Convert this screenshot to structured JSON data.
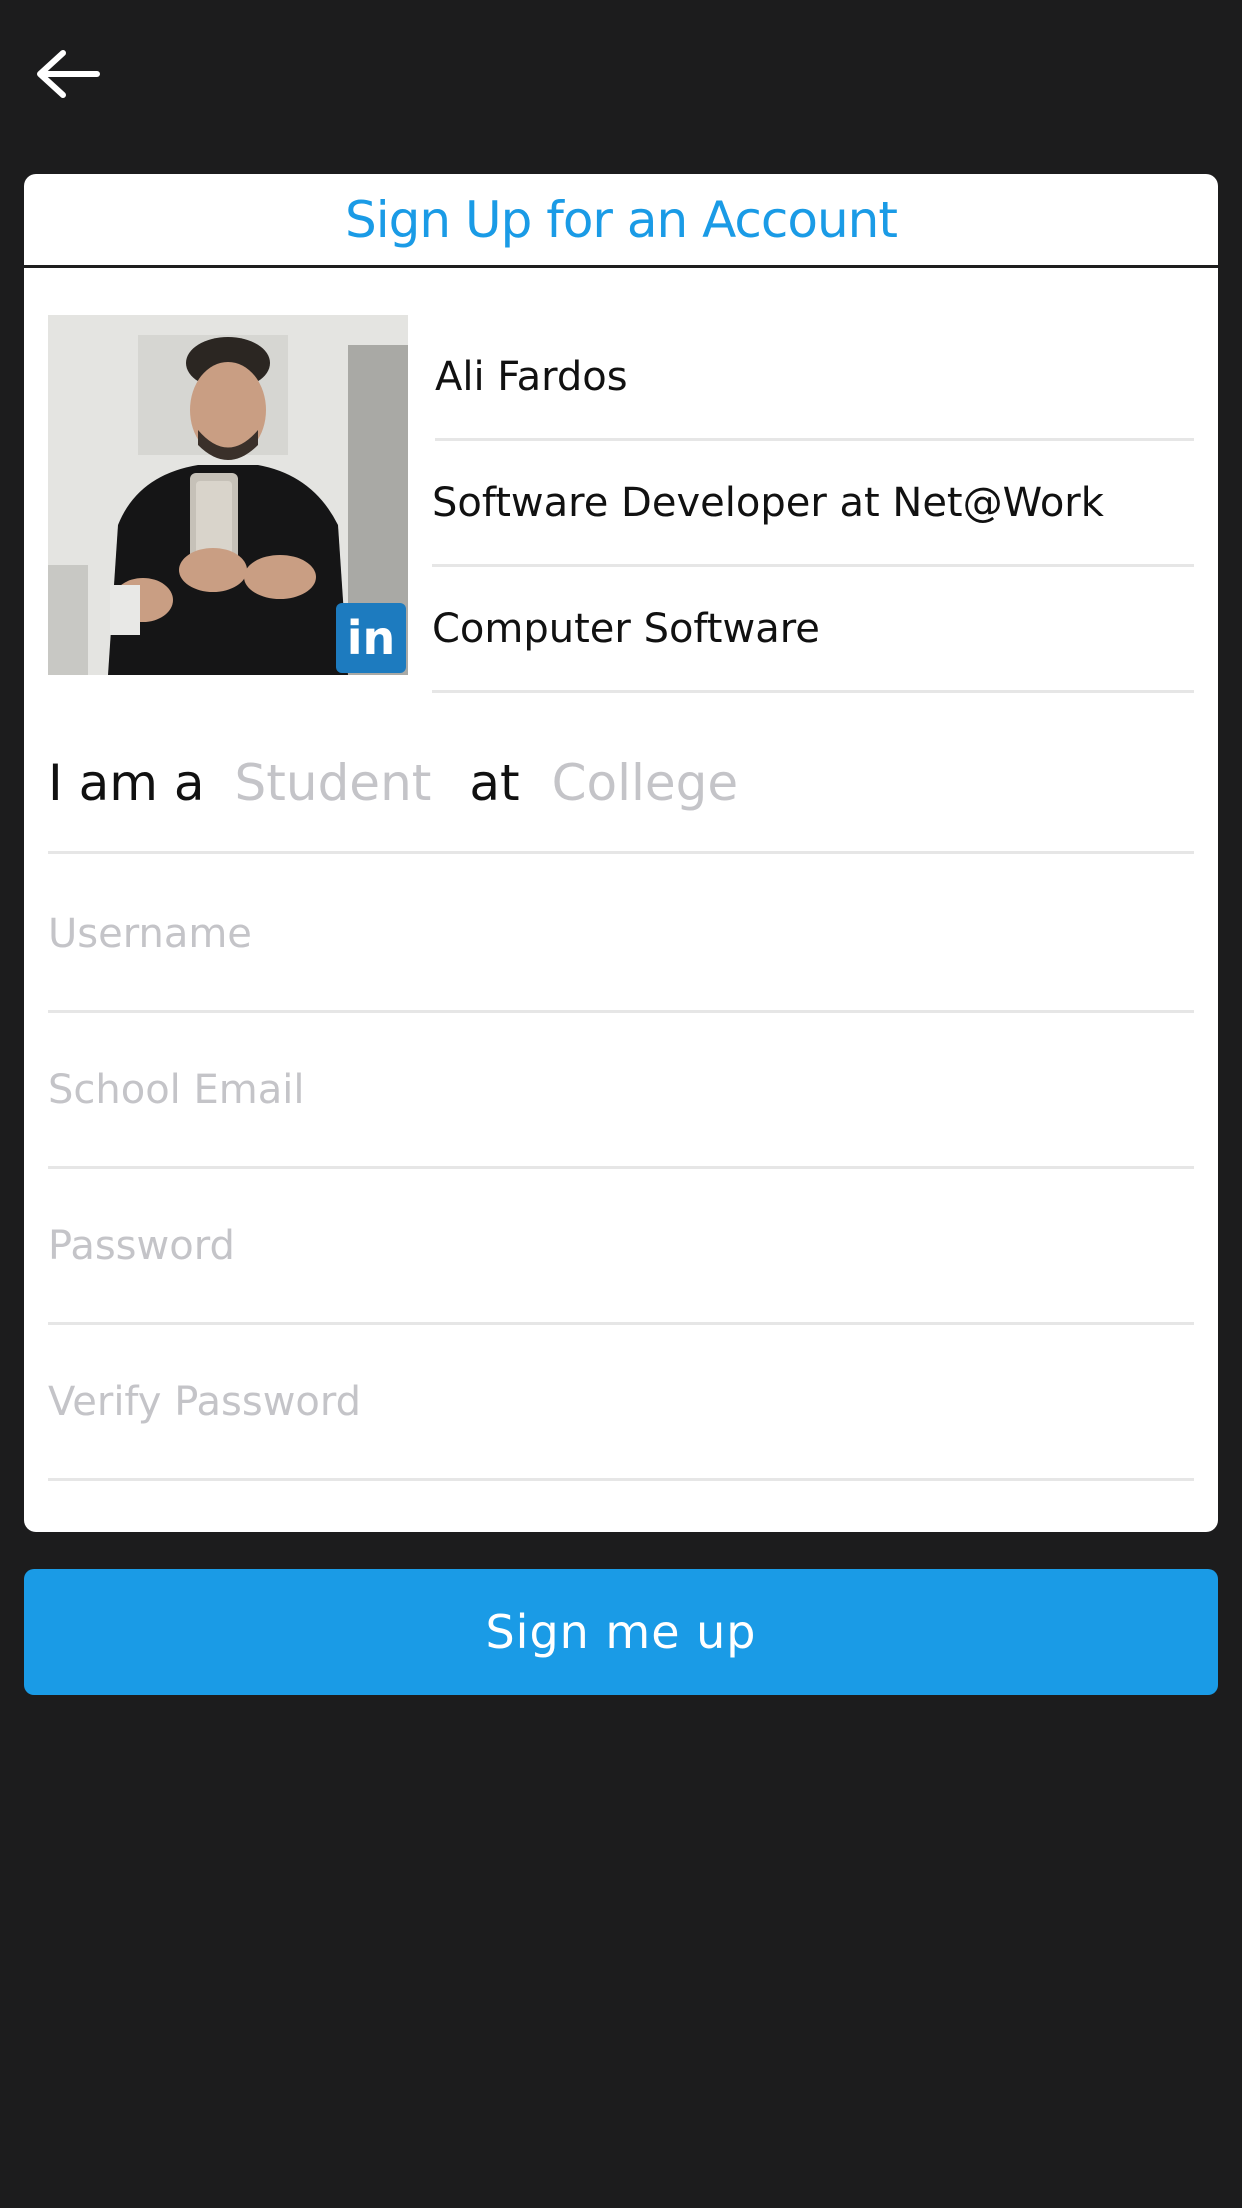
{
  "header": {
    "back_icon": "arrow-left-icon"
  },
  "card": {
    "title": "Sign Up for an Account",
    "profile": {
      "name": "Ali Fardos",
      "headline": "Software Developer at Net@Work",
      "industry": "Computer Software",
      "badge": "in",
      "badge_icon": "linkedin-icon"
    },
    "role_row": {
      "prefix": "I am a",
      "role_placeholder": "Student",
      "connector": "at",
      "school_placeholder": "College"
    },
    "fields": {
      "username_placeholder": "Username",
      "email_placeholder": "School Email",
      "password_placeholder": "Password",
      "verify_placeholder": "Verify Password"
    }
  },
  "submit": {
    "label": "Sign me up"
  },
  "colors": {
    "background": "#1c1c1d",
    "accent": "#1a9be6",
    "linkedin": "#1d7bbf",
    "placeholder": "#c4c4c8"
  }
}
